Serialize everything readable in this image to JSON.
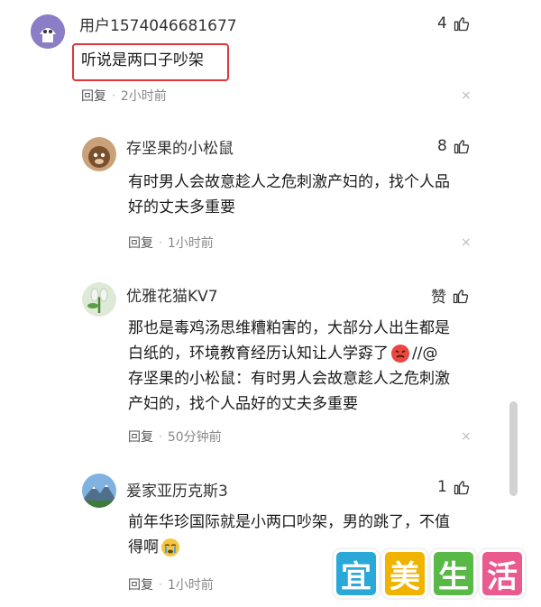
{
  "comments": [
    {
      "username": "用户1574046681677",
      "likes": "4",
      "text": "听说是两口子吵架",
      "reply_label": "回复",
      "time": "2小时前",
      "close": "×"
    },
    {
      "username": "存坚果的小松鼠",
      "likes": "8",
      "text_lines": [
        "有时男人会故意趁人之危刺激产妇的，找个人品",
        "好的丈夫多重要"
      ],
      "reply_label": "回复",
      "time": "1小时前",
      "close": "×"
    },
    {
      "username": "优雅花猫KV7",
      "likes": "赞",
      "text_lines": [
        "那也是毒鸡汤思维糟粕害的，大部分人出生都是",
        "白纸的，环境教育经历认知让人学孬了",
        "存坚果的小松鼠：有时男人会故意趁人之危刺激",
        "产妇的，找个人品好的丈夫多重要"
      ],
      "emoji_after": "//@",
      "reply_label": "回复",
      "time": "50分钟前",
      "close": "×"
    },
    {
      "username": "爰家亚历克斯3",
      "likes": "1",
      "text_lines": [
        "前年华珍国际就是小两口吵架，男的跳了，不值",
        "得啊"
      ],
      "reply_label": "回复",
      "time": "1小时前",
      "close": "×"
    }
  ],
  "watermark": [
    "宜",
    "美",
    "生",
    "活"
  ],
  "colors": {
    "highlight": "#e0353a",
    "watermark": [
      "#2aa8d8",
      "#f0b400",
      "#58b947",
      "#ea5a8f"
    ]
  }
}
